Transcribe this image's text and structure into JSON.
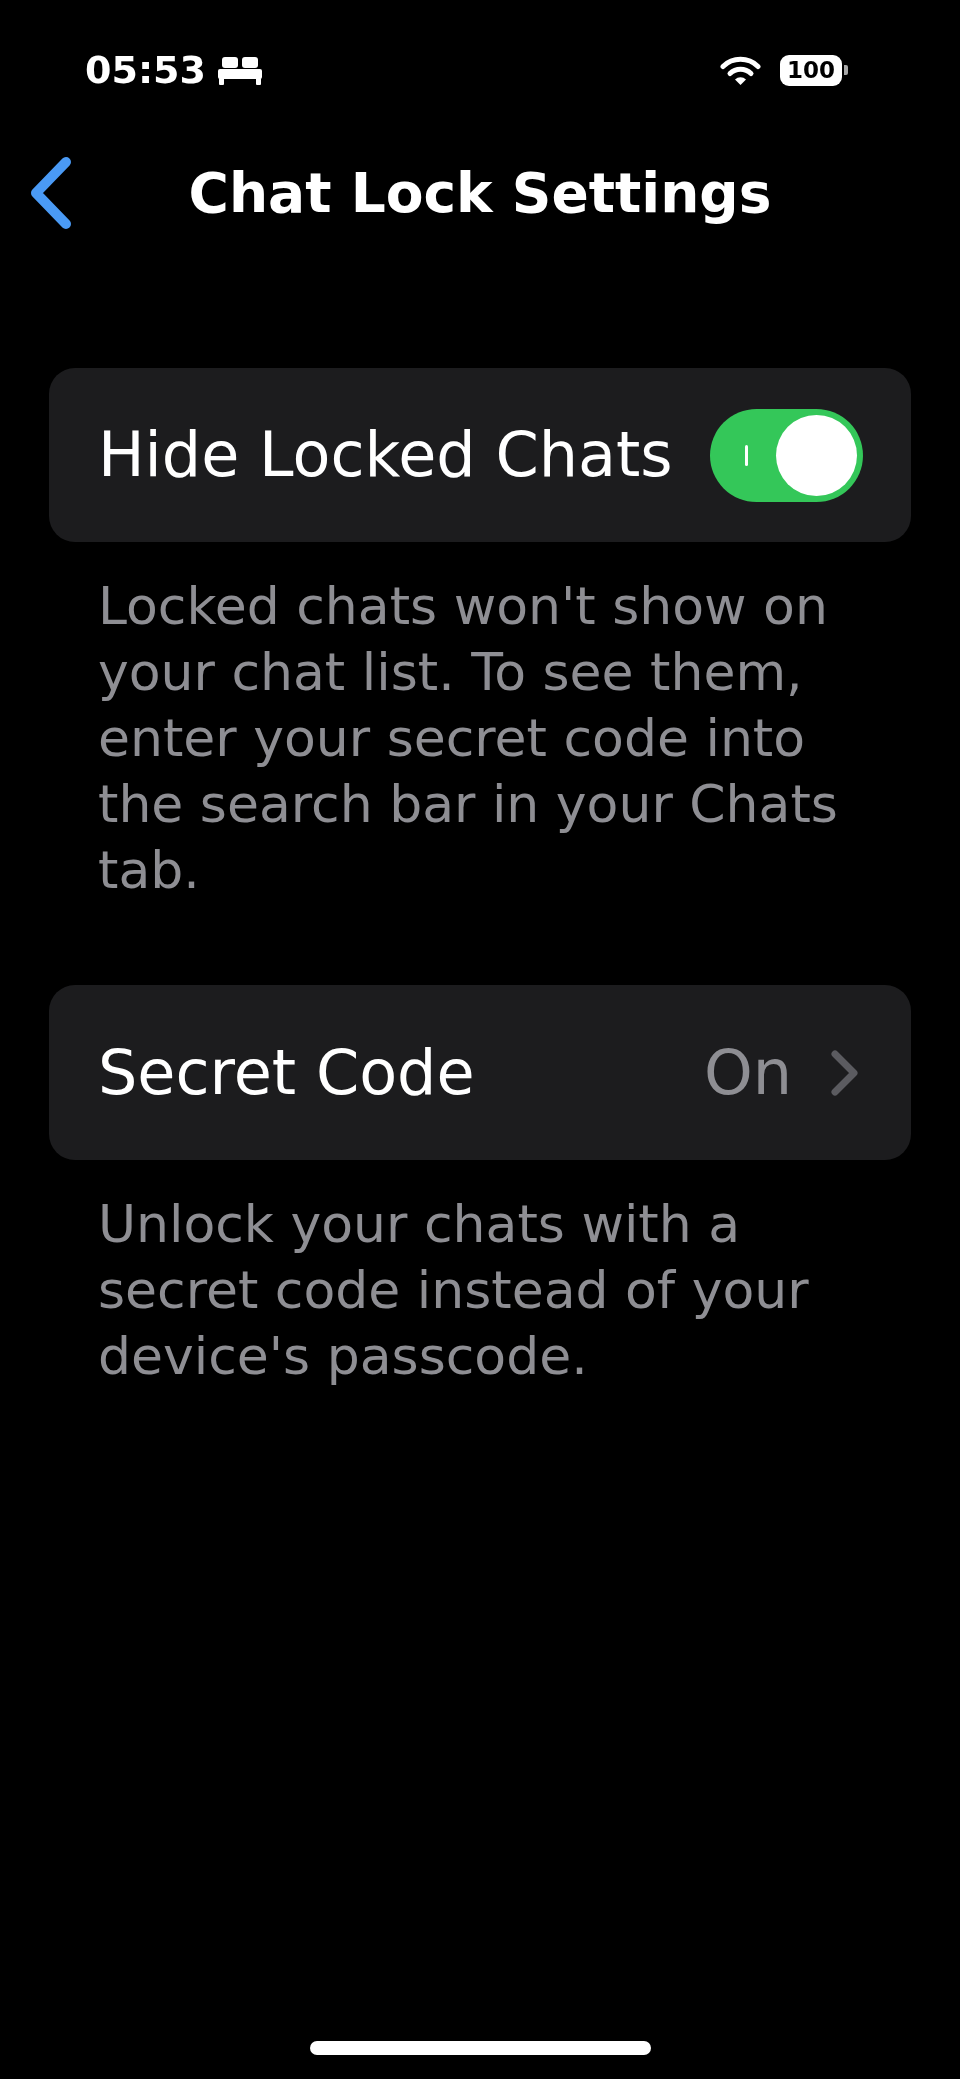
{
  "status_bar": {
    "time": "05:53",
    "battery": "100"
  },
  "nav": {
    "title": "Chat Lock Settings"
  },
  "sections": [
    {
      "kind": "toggle",
      "label": "Hide Locked Chats",
      "on": true,
      "footer": "Locked chats won't show on your chat list. To see them, enter your secret code into the search bar in your Chats tab."
    },
    {
      "kind": "link",
      "label": "Secret Code",
      "value": "On",
      "footer": "Unlock your chats with a secret code instead of your device's passcode."
    }
  ]
}
